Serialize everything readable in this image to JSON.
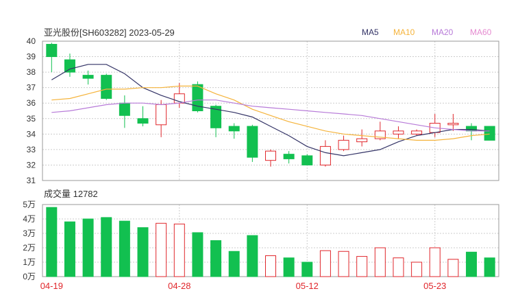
{
  "header": {
    "title": "亚光股份[SH603282] 2023-05-29"
  },
  "legend": [
    {
      "name": "MA5",
      "color": "#333366"
    },
    {
      "name": "MA10",
      "color": "#f5b33a"
    },
    {
      "name": "MA20",
      "color": "#b77ad8"
    },
    {
      "name": "MA60",
      "color": "#e58ad0"
    }
  ],
  "colors": {
    "up": "#e0262b",
    "down": "#12c050",
    "grid": "#cccccc",
    "frame": "#999999"
  },
  "volume_label": "成交量 12782",
  "chart_data": [
    {
      "type": "candlestick",
      "title": "亚光股份[SH603282] 2023-05-29",
      "ylim": [
        31,
        40
      ],
      "yticks": [
        "31",
        "32",
        "33",
        "34",
        "35",
        "36",
        "37",
        "38",
        "39",
        "40"
      ],
      "x_tick_labels": [
        {
          "index": 0,
          "label": "04-19"
        },
        {
          "index": 7,
          "label": "04-28"
        },
        {
          "index": 14,
          "label": "05-12"
        },
        {
          "index": 21,
          "label": "05-23"
        }
      ],
      "candles": [
        {
          "open": 39.8,
          "high": 39.9,
          "low": 38.0,
          "close": 39.0
        },
        {
          "open": 38.8,
          "high": 39.2,
          "low": 37.7,
          "close": 38.0
        },
        {
          "open": 37.8,
          "high": 38.1,
          "low": 37.2,
          "close": 37.6
        },
        {
          "open": 37.8,
          "high": 37.9,
          "low": 36.2,
          "close": 36.3
        },
        {
          "open": 36.0,
          "high": 36.5,
          "low": 34.4,
          "close": 35.2
        },
        {
          "open": 35.0,
          "high": 35.8,
          "low": 34.5,
          "close": 34.7
        },
        {
          "open": 34.6,
          "high": 36.2,
          "low": 33.8,
          "close": 35.9
        },
        {
          "open": 36.0,
          "high": 37.3,
          "low": 35.7,
          "close": 36.6
        },
        {
          "open": 37.2,
          "high": 37.4,
          "low": 35.4,
          "close": 35.5
        },
        {
          "open": 35.8,
          "high": 35.9,
          "low": 33.8,
          "close": 34.4
        },
        {
          "open": 34.5,
          "high": 34.7,
          "low": 33.7,
          "close": 34.2
        },
        {
          "open": 34.5,
          "high": 34.6,
          "low": 32.2,
          "close": 32.5
        },
        {
          "open": 32.3,
          "high": 33.0,
          "low": 31.9,
          "close": 32.9
        },
        {
          "open": 32.7,
          "high": 32.9,
          "low": 32.1,
          "close": 32.4
        },
        {
          "open": 32.6,
          "high": 32.7,
          "low": 32.0,
          "close": 32.0
        },
        {
          "open": 32.0,
          "high": 33.6,
          "low": 31.9,
          "close": 33.2
        },
        {
          "open": 33.0,
          "high": 33.9,
          "low": 32.9,
          "close": 33.6
        },
        {
          "open": 33.5,
          "high": 34.3,
          "low": 33.2,
          "close": 33.7
        },
        {
          "open": 33.7,
          "high": 34.8,
          "low": 33.6,
          "close": 34.2
        },
        {
          "open": 34.0,
          "high": 34.5,
          "low": 33.7,
          "close": 34.2
        },
        {
          "open": 34.0,
          "high": 34.3,
          "low": 33.9,
          "close": 34.2
        },
        {
          "open": 34.1,
          "high": 35.3,
          "low": 33.8,
          "close": 34.7
        },
        {
          "open": 34.6,
          "high": 35.3,
          "low": 34.2,
          "close": 34.7
        },
        {
          "open": 34.5,
          "high": 34.7,
          "low": 33.6,
          "close": 34.2
        },
        {
          "open": 34.5,
          "high": 34.5,
          "low": 33.6,
          "close": 33.6
        }
      ],
      "ma_series": [
        {
          "name": "MA5",
          "values": [
            37.5,
            38.2,
            38.5,
            38.5,
            37.9,
            37.0,
            36.5,
            36.1,
            35.8,
            35.6,
            35.4,
            35.1,
            34.5,
            33.9,
            33.2,
            32.8,
            32.6,
            32.8,
            33.0,
            33.5,
            33.9,
            34.1,
            34.3,
            34.3,
            34.2
          ]
        },
        {
          "name": "MA10",
          "values": [
            36.2,
            36.3,
            36.6,
            36.9,
            36.9,
            37.0,
            37.0,
            37.1,
            37.1,
            36.6,
            36.2,
            35.6,
            35.2,
            34.8,
            34.5,
            34.2,
            34.0,
            33.9,
            33.8,
            33.7,
            33.6,
            33.6,
            33.7,
            33.9,
            34.0
          ]
        },
        {
          "name": "MA20",
          "values": [
            35.4,
            35.5,
            35.7,
            35.9,
            36.0,
            36.0,
            35.9,
            36.0,
            36.2,
            36.2,
            36.0,
            35.8,
            35.7,
            35.6,
            35.5,
            35.4,
            35.3,
            35.2,
            35.0,
            34.8,
            34.6,
            34.4,
            34.3,
            34.2,
            34.2
          ]
        }
      ]
    },
    {
      "type": "bar",
      "title": "成交量 12782",
      "ylim": [
        0,
        5
      ],
      "yticks": [
        "0万",
        "1万",
        "2万",
        "3万",
        "4万",
        "5万"
      ],
      "values": [
        4.8,
        3.8,
        4.0,
        4.1,
        3.85,
        3.4,
        3.7,
        3.65,
        3.05,
        2.5,
        1.75,
        2.85,
        1.45,
        1.3,
        1.0,
        1.8,
        1.75,
        1.4,
        2.0,
        1.3,
        1.0,
        2.0,
        1.2,
        1.7,
        1.3
      ]
    }
  ]
}
